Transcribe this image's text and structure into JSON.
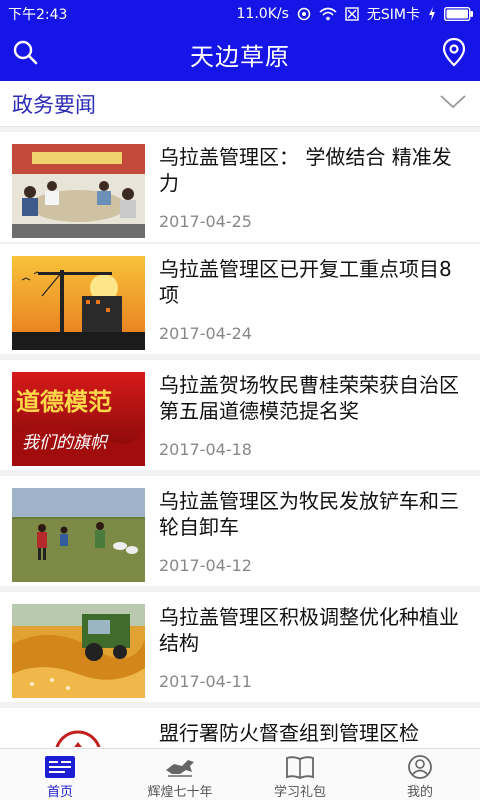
{
  "status_bar": {
    "time": "下午2:43",
    "net_speed": "11.0K/s",
    "sim": "无SIM卡"
  },
  "app_bar": {
    "title": "天边草原",
    "search_icon": "search-icon",
    "location_icon": "location-pin-icon"
  },
  "section": {
    "title": "政务要闻",
    "toggle_icon": "chevron-down-icon"
  },
  "news": [
    {
      "title": "乌拉盖管理区： 学做结合 精准发力",
      "date": "2017-04-25"
    },
    {
      "title": "乌拉盖管理区已开复工重点项目8项",
      "date": "2017-04-24"
    },
    {
      "title": "乌拉盖贺场牧民曹桂荣荣获自治区第五届道德模范提名奖",
      "date": "2017-04-18"
    },
    {
      "title": "乌拉盖管理区为牧民发放铲车和三轮自卸车",
      "date": "2017-04-12"
    },
    {
      "title": "乌拉盖管理区积极调整优化种植业结构",
      "date": "2017-04-11"
    },
    {
      "title": "盟行署防火督查组到管理区检",
      "date": ""
    }
  ],
  "thumb_text": {
    "moral_1": "道德模范",
    "moral_2": "我们的旗帜"
  },
  "tabs": [
    {
      "label": "首页",
      "icon": "news-icon",
      "active": true
    },
    {
      "label": "辉煌七十年",
      "icon": "horse-icon",
      "active": false
    },
    {
      "label": "学习礼包",
      "icon": "book-icon",
      "active": false
    },
    {
      "label": "我的",
      "icon": "user-icon",
      "active": false
    }
  ],
  "colors": {
    "brand_blue": "#1515e8",
    "section_title": "#2b2bb7",
    "active_tab": "#1d1dd6"
  }
}
